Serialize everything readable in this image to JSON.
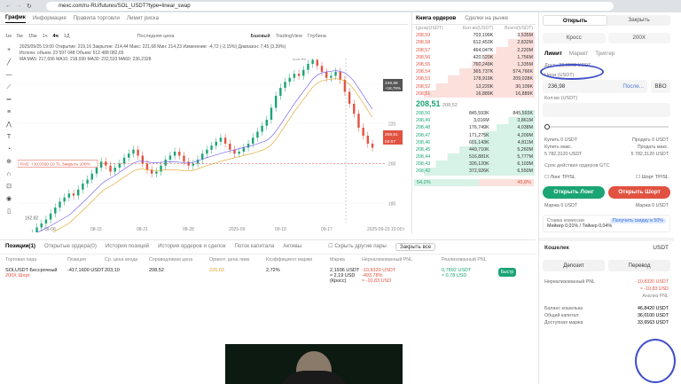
{
  "browser": {
    "url": "mexc.com/ru-RU/futures/SOL_USDT?type=linear_swap"
  },
  "tabs": [
    "График",
    "Информация",
    "Правила торговли",
    "Лимит риска"
  ],
  "toolbar": {
    "intervals": [
      "1м",
      "5м",
      "15м",
      "1ч",
      "4ч",
      "1Д"
    ],
    "active": "4ч",
    "last_price": "Последняя цена",
    "views": [
      "Базовый",
      "TradingView",
      "Глубина"
    ]
  },
  "chart_info": {
    "line1": "2025/09/25 19:00  Открытие: 219,16  Закрытие: 214,44  Макс: 221,68  Мин: 214,23  Изменение: -4,72 (-2,15%)  Диапазон: 7,45 (3,39%)",
    "line2": "Исполн. объем: 23 597 048   Объем: 512 488 082,65",
    "line3": "MA  MA5: 217,696  MA10: 218,930  MA30: 232,533  MA60: 236,2328"
  },
  "chart_data": {
    "type": "candlestick",
    "ylim": [
      170,
      250
    ],
    "x_labels": [
      "08-08",
      "08-15",
      "08-21",
      "08-28",
      "2025-09",
      "09-10",
      "09-17",
      "2025-09-23 15:00:00"
    ],
    "y_labels": [
      "240",
      "220",
      "200",
      "180"
    ],
    "markers": {
      "high": "253.49",
      "low": "162.82"
    },
    "price_tags": [
      {
        "text": "249,89",
        "sub": "+18,79%"
      },
      {
        "text": "208,51"
      },
      {
        "text": "03:07"
      }
    ],
    "position_line": "РАБ: +10,0320  10  TL  Закрыть 100%",
    "closes": [
      163,
      165,
      168,
      170,
      172,
      175,
      178,
      181,
      183,
      185,
      184,
      187,
      190,
      192,
      195,
      198,
      201,
      199,
      196,
      198,
      200,
      203,
      205,
      207,
      204,
      200,
      197,
      195,
      196,
      199,
      202,
      204,
      206,
      204,
      201,
      199,
      200,
      202,
      205,
      207,
      209,
      211,
      213,
      210,
      207,
      205,
      206,
      208,
      210,
      213,
      216,
      219,
      222,
      228,
      234,
      238,
      241,
      243,
      245,
      244,
      247,
      250,
      252,
      249,
      246,
      243,
      244,
      246,
      242,
      236,
      230,
      225,
      218,
      214,
      210,
      208
    ]
  },
  "orderbook": {
    "tabs": [
      "Книга ордеров",
      "Сделки на рынке"
    ],
    "headers": [
      "Цена(USDT)",
      "Кол-во(USDT)",
      "Всего(USDT)"
    ],
    "asks": [
      [
        "208,59",
        "703,199K",
        "3,535M"
      ],
      [
        "208,58",
        "612,453K",
        "2,832M"
      ],
      [
        "208,57",
        "464,047K",
        "2,220M"
      ],
      [
        "208,56",
        "420,520K",
        "1,756M"
      ],
      [
        "208,55",
        "760,249K",
        "1,335M"
      ],
      [
        "208,54",
        "365,737K",
        "574,766K"
      ],
      [
        "208,53",
        "178,919K",
        "209,028K"
      ],
      [
        "208,52",
        "13,220K",
        "30,109K"
      ],
      [
        "208,51",
        "16,889K",
        "16,889K"
      ]
    ],
    "last": "208,51",
    "last_sub": "208,52",
    "bids": [
      [
        "208,50",
        "845,593K",
        "845,593K"
      ],
      [
        "208,49",
        "3,016M",
        "3,861M"
      ],
      [
        "208,48",
        "176,749K",
        "4,038M"
      ],
      [
        "208,47",
        "171,275K",
        "4,209M"
      ],
      [
        "208,46",
        "601,143K",
        "4,811M"
      ],
      [
        "208,45",
        "449,710K",
        "5,260M"
      ],
      [
        "208,44",
        "516,881K",
        "5,777M"
      ],
      [
        "208,43",
        "326,120K",
        "6,103M"
      ],
      [
        "208,42",
        "372,926K",
        "6,550M"
      ]
    ],
    "ratio_b": "54,2%",
    "ratio_s": "45,8%"
  },
  "bottom": {
    "tabs": [
      "Позиции(1)",
      "Открытые ордера(0)",
      "История позиций",
      "История ордеров и сделок",
      "Поток капитала",
      "Активы"
    ],
    "hide_other": "Скрыть другие пары",
    "close_all": "Закрыть все",
    "headers": [
      "Торговая пара",
      "Позиция",
      "Ср. цена входа",
      "Справедливая цена",
      "Ориент. цена ликв.",
      "Коэффициент маржи",
      "Маржа",
      "Нереализованный PNL",
      "Реализованный PNL"
    ],
    "row": {
      "pair": "SOLUSDT Бессрочный",
      "lev": "200X Шорт",
      "position": "-417,1600 USDT",
      "avg": "203,10",
      "fair": "208,52",
      "liq": "226,03",
      "ratio": "2,72%",
      "margin": "2,1936 USDT",
      "margin2": "≈ 2,19 USD",
      "margin3": "(Кросс)",
      "upnl": "-10,8320 USDT",
      "upnl2": "-493,78%",
      "upnl3": "≈ -10,83 USD",
      "rpnl": "0,7892 USDT",
      "rpnl2": "≈ 0,78 USD",
      "btn": "Быстр"
    }
  },
  "right": {
    "tabs": [
      "Открыть",
      "Закрыть"
    ],
    "mode": [
      "Кросс",
      "200X"
    ],
    "order_types": [
      "Лимит",
      "Маркет",
      "Триггер"
    ],
    "avail": "Дост.: 33,6563 USDT",
    "price_label": "Цена (USDT)",
    "price": "236,98",
    "last": "После...",
    "bbo": "BBO",
    "qty_label": "Кол-во (USDT)",
    "kv": [
      [
        "Купить 0 USDT",
        "Продать 0 USDT"
      ],
      [
        "Купить макс.",
        "Продать макс."
      ],
      [
        "5 782,3120 USDT",
        "5 782,3120 USDT"
      ]
    ],
    "tif": "Срок действия ордеров  GTC",
    "tpsl": [
      "Лонг TP/SL",
      "Шорт TP/SL"
    ],
    "open_long": "Открыть Лонг",
    "open_short": "Открыть Шорт",
    "margin_kv": [
      "Маржа 0 USDT",
      "Маржа 0 USDT"
    ],
    "fee_label": "Ставка комиссии",
    "fee": "Мейкер 0,01% / Тейкер 0,04%",
    "discount": "Получить скидку в 50%",
    "wallet": "Кошелек",
    "wallet_cur": "USDT",
    "deposit": "Депозит",
    "transfer": "Перевод",
    "upnl_label": "Нереализованный PNL",
    "upnl": "-10,8320 USDT",
    "upnl2": "≈ -10,83 USD",
    "share": "Анализ PNL",
    "balances": [
      [
        "Баланс кошелька",
        "46,8420 USDT"
      ],
      [
        "Общий капитал",
        "36,0100 USDT"
      ],
      [
        "Доступная маржа",
        "33,6563 USDT"
      ]
    ]
  }
}
